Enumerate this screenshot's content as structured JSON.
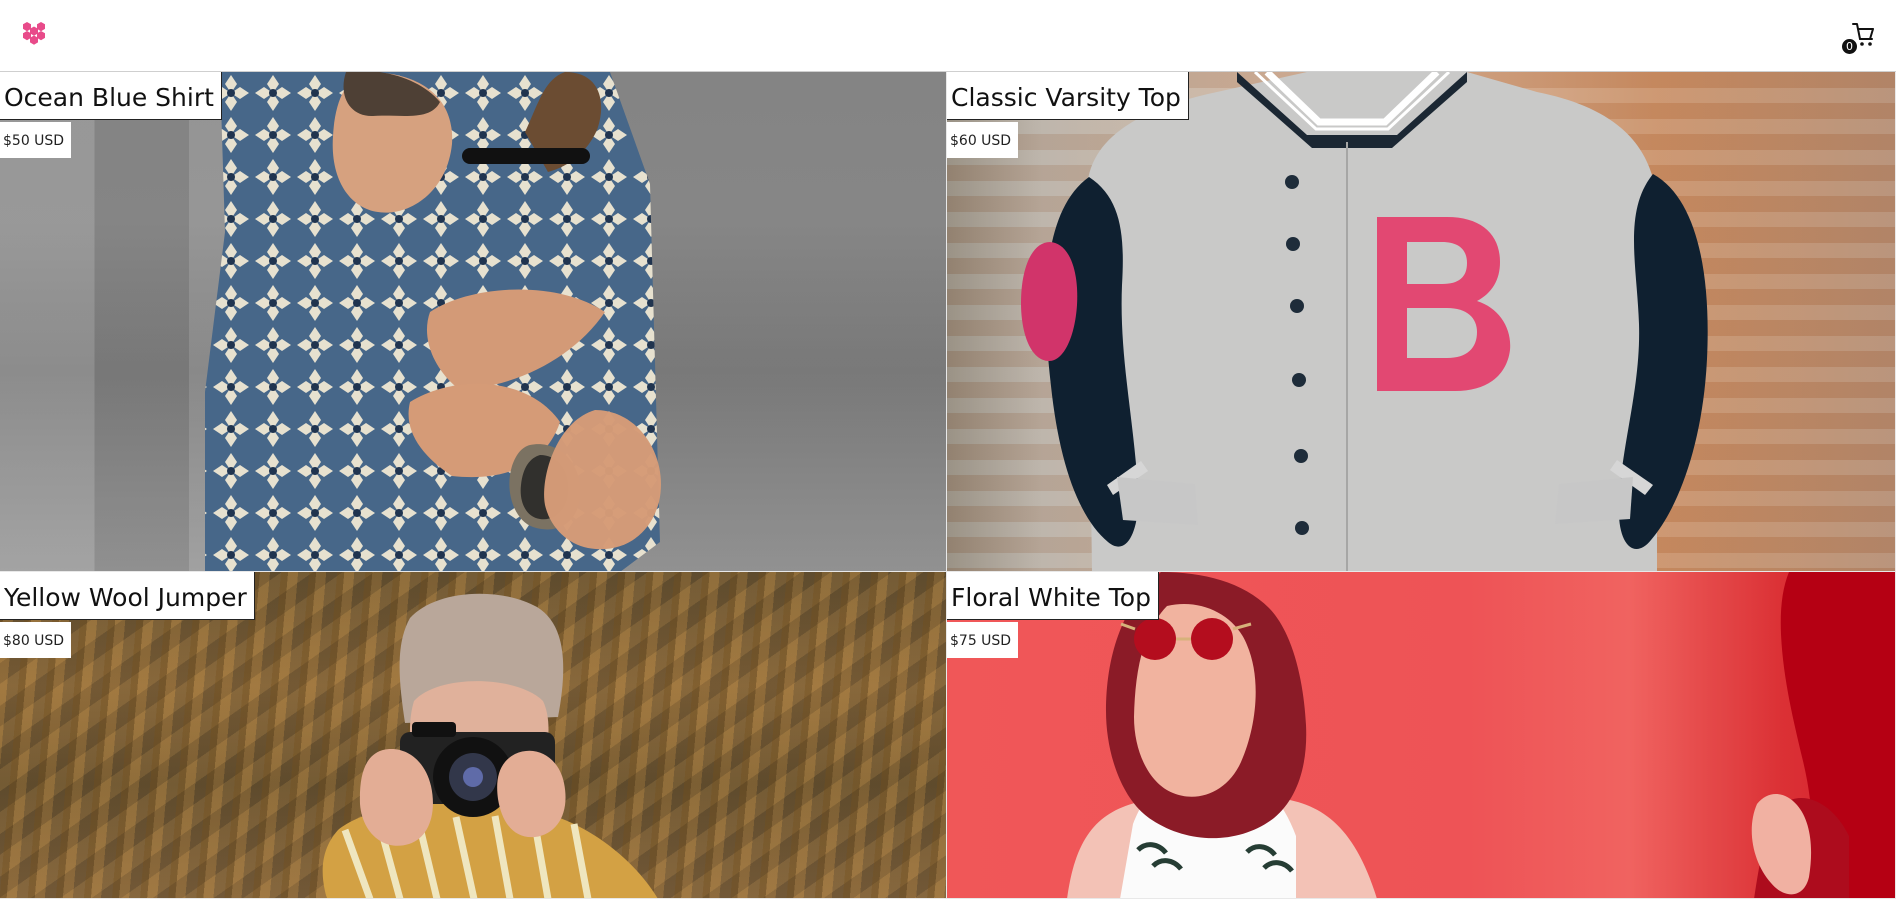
{
  "header": {
    "logo_icon": "flower-icon",
    "cart_icon": "shopping-cart-icon",
    "cart_count": "0",
    "brand_color": "#e84b8a"
  },
  "products": [
    {
      "title": "Ocean Blue Shirt",
      "price": "$50 USD",
      "image_theme": "patterned-blue-shirt-on-concrete"
    },
    {
      "title": "Classic Varsity Top",
      "price": "$60 USD",
      "image_theme": "varsity-jacket-on-brick-wall"
    },
    {
      "title": "Yellow Wool Jumper",
      "price": "$80 USD",
      "image_theme": "camera-in-cornfield"
    },
    {
      "title": "Floral White Top",
      "price": "$75 USD",
      "image_theme": "woman-in-red-sunglasses-on-red-wall"
    }
  ]
}
